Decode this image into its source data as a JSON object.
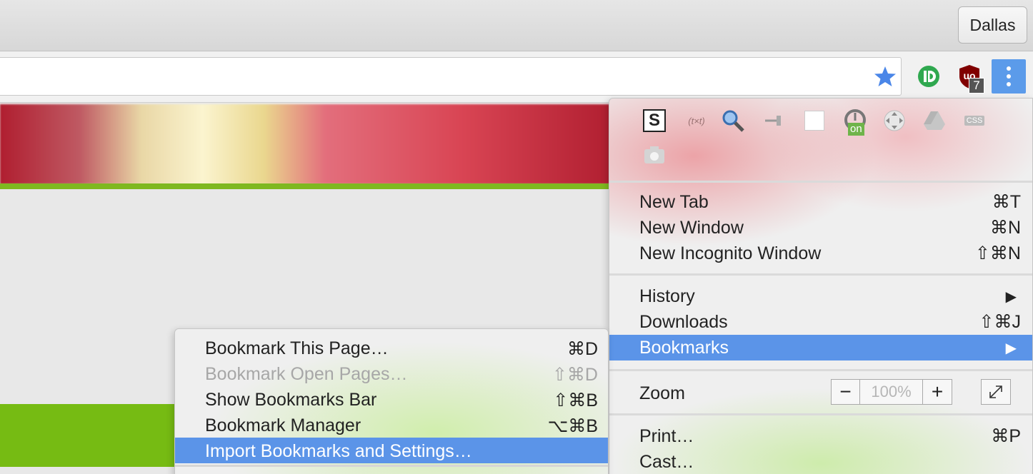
{
  "profile": {
    "name": "Dallas"
  },
  "toolbar": {
    "ublock_badge": "7"
  },
  "extensions": [
    {
      "name": "s-icon",
      "label": "S"
    },
    {
      "name": "txt-icon",
      "label": "(t×t)"
    },
    {
      "name": "magnifier-icon"
    },
    {
      "name": "pin-icon"
    },
    {
      "name": "blank-page-icon"
    },
    {
      "name": "timer-on-icon",
      "badge": "on"
    },
    {
      "name": "move-icon"
    },
    {
      "name": "drive-icon"
    },
    {
      "name": "css-icon",
      "label": "CSS"
    },
    {
      "name": "camera-icon"
    }
  ],
  "menu": {
    "new_tab": "New Tab",
    "new_tab_sc": "⌘T",
    "new_window": "New Window",
    "new_window_sc": "⌘N",
    "incognito": "New Incognito Window",
    "incognito_sc": "⇧⌘N",
    "history": "History",
    "downloads": "Downloads",
    "downloads_sc": "⇧⌘J",
    "bookmarks": "Bookmarks",
    "zoom": "Zoom",
    "zoom_value": "100%",
    "print": "Print…",
    "print_sc": "⌘P",
    "cast": "Cast…"
  },
  "submenu": {
    "items": [
      {
        "label": "Bookmark This Page…",
        "shortcut": "⌘D"
      },
      {
        "label": "Bookmark Open Pages…",
        "shortcut": "⇧⌘D"
      },
      {
        "label": "Show Bookmarks Bar",
        "shortcut": "⇧⌘B"
      },
      {
        "label": "Bookmark Manager",
        "shortcut": "⌥⌘B"
      },
      {
        "label": "Import Bookmarks and Settings…",
        "shortcut": ""
      }
    ]
  },
  "colors": {
    "accent": "#5b94e8",
    "green": "#76bb13"
  }
}
